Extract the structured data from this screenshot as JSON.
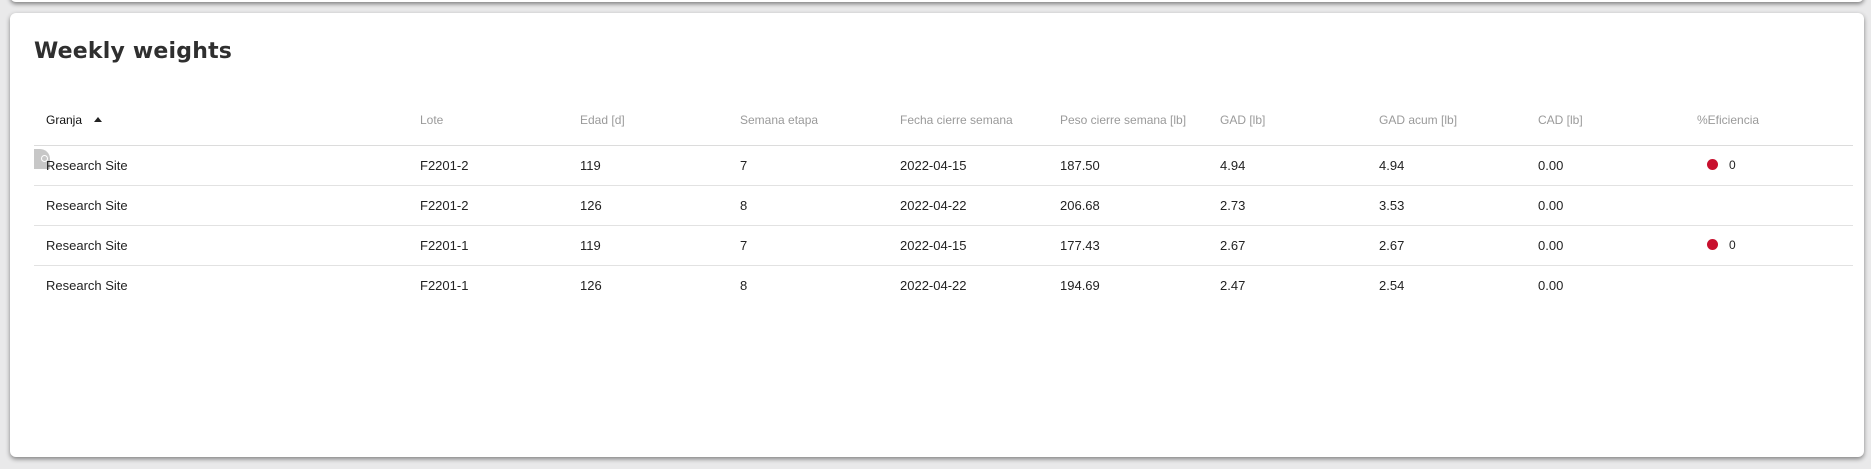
{
  "title": "Weekly weights",
  "colors": {
    "efficiency_dot": "#c8102e",
    "page_bg": "#e9e9ea"
  },
  "table": {
    "columns": [
      {
        "key": "granja",
        "label": "Granja",
        "sorted": "asc"
      },
      {
        "key": "lote",
        "label": "Lote"
      },
      {
        "key": "edad",
        "label": "Edad [d]"
      },
      {
        "key": "semana",
        "label": "Semana etapa"
      },
      {
        "key": "fecha",
        "label": "Fecha cierre semana"
      },
      {
        "key": "peso",
        "label": "Peso cierre semana [lb]"
      },
      {
        "key": "gad",
        "label": "GAD [lb]"
      },
      {
        "key": "gad_acum",
        "label": "GAD acum [lb]"
      },
      {
        "key": "cad",
        "label": "CAD [lb]"
      },
      {
        "key": "eficiencia",
        "label": "%Eficiencia"
      }
    ],
    "rows": [
      {
        "granja": "Research Site",
        "lote": "F2201-2",
        "edad": "119",
        "semana": "7",
        "fecha": "2022-04-15",
        "peso": "187.50",
        "gad": "4.94",
        "gad_acum": "4.94",
        "cad": "0.00",
        "eficiencia": "0",
        "eficiencia_status": "red"
      },
      {
        "granja": "Research Site",
        "lote": "F2201-2",
        "edad": "126",
        "semana": "8",
        "fecha": "2022-04-22",
        "peso": "206.68",
        "gad": "2.73",
        "gad_acum": "3.53",
        "cad": "0.00",
        "eficiencia": null,
        "eficiencia_status": null
      },
      {
        "granja": "Research Site",
        "lote": "F2201-1",
        "edad": "119",
        "semana": "7",
        "fecha": "2022-04-15",
        "peso": "177.43",
        "gad": "2.67",
        "gad_acum": "2.67",
        "cad": "0.00",
        "eficiencia": "0",
        "eficiencia_status": "red"
      },
      {
        "granja": "Research Site",
        "lote": "F2201-1",
        "edad": "126",
        "semana": "8",
        "fecha": "2022-04-22",
        "peso": "194.69",
        "gad": "2.47",
        "gad_acum": "2.54",
        "cad": "0.00",
        "eficiencia": null,
        "eficiencia_status": null
      }
    ]
  }
}
